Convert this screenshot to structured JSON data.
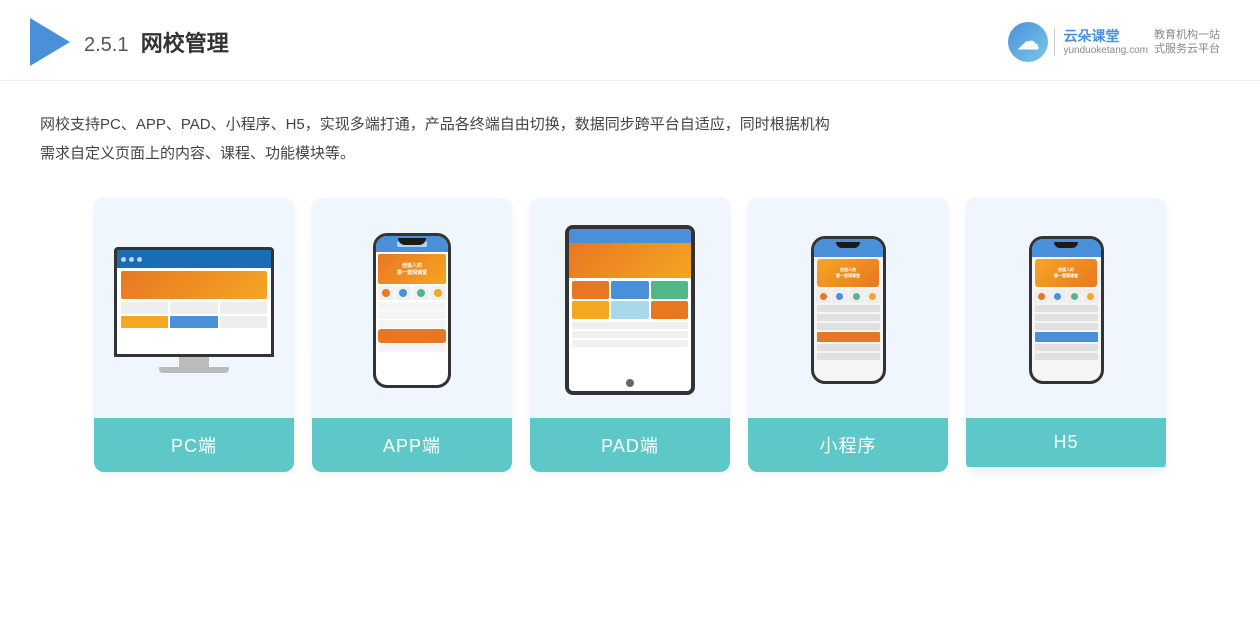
{
  "header": {
    "section_number": "2.5.1",
    "title": "网校管理",
    "brand_name": "云朵课堂",
    "brand_domain": "yunduoketang.com",
    "brand_slogan_line1": "教育机构一站",
    "brand_slogan_line2": "式服务云平台"
  },
  "description": {
    "line1": "网校支持PC、APP、PAD、小程序、H5，实现多端打通，产品各终端自由切换，数据同步跨平台自适应，同时根据机构",
    "line2": "需求自定义页面上的内容、课程、功能模块等。"
  },
  "cards": [
    {
      "id": "pc",
      "label": "PC端"
    },
    {
      "id": "app",
      "label": "APP端"
    },
    {
      "id": "pad",
      "label": "PAD端"
    },
    {
      "id": "miniprogram",
      "label": "小程序"
    },
    {
      "id": "h5",
      "label": "H5"
    }
  ]
}
